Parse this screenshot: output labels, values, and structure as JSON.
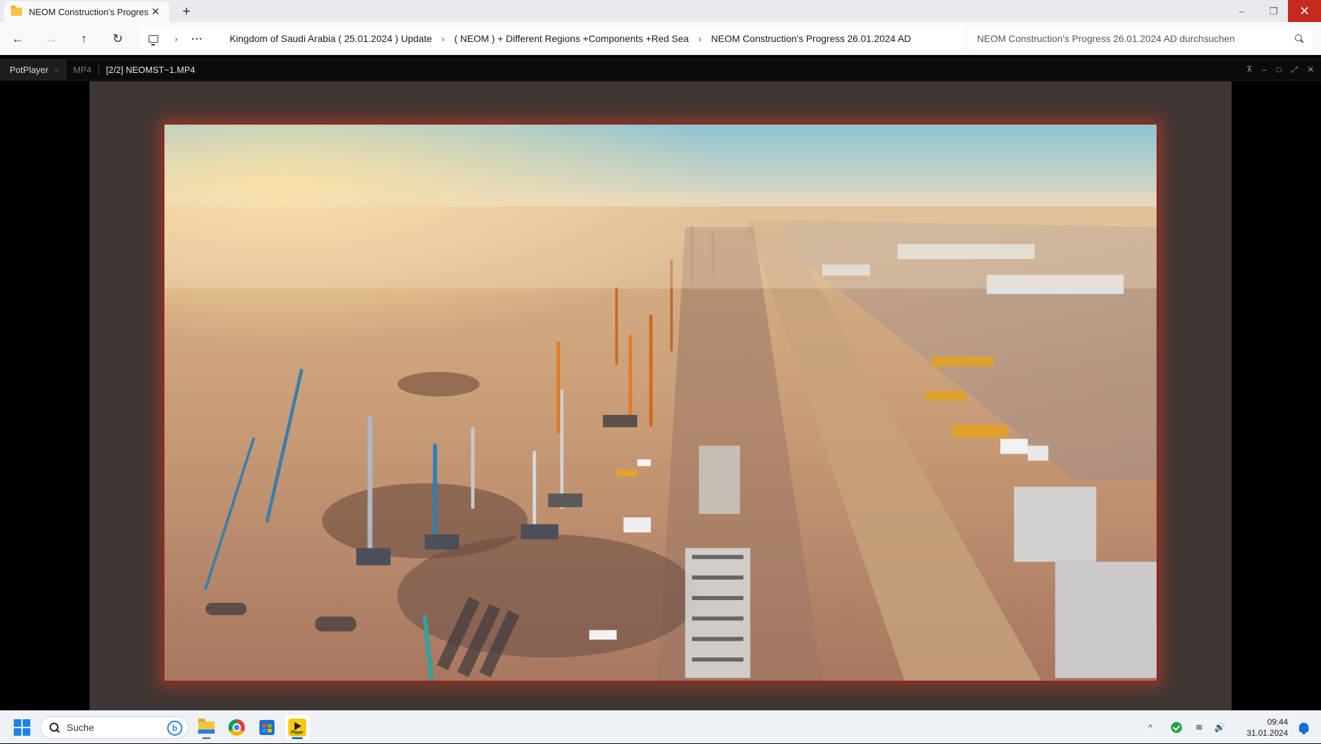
{
  "explorer": {
    "tab": {
      "title": "NEOM Construction's Progress",
      "close_glyph": "✕",
      "icon": "folder-icon"
    },
    "new_tab_glyph": "+",
    "window_controls": {
      "minimize": "–",
      "maximize": "❐",
      "close": "✕"
    },
    "nav": {
      "back": "←",
      "forward": "→",
      "up": "↑",
      "refresh": "↻"
    },
    "breadcrumb": {
      "overflow": "···",
      "items": [
        "Kingdom of Saudi Arabia ( 25.01.2024 ) Update",
        "( NEOM ) + Different Regions +Components +Red Sea",
        "NEOM Construction's Progress 26.01.2024 AD"
      ]
    },
    "search": {
      "placeholder": "NEOM Construction's Progress 26.01.2024 AD durchsuchen"
    }
  },
  "player": {
    "menu_label": "PotPlayer",
    "format": "MP4",
    "file_label": "[2/2] NEOMST~1.MP4",
    "controls": {
      "pin": "⊼",
      "minimize": "–",
      "maximize": "□",
      "fullscreen": "⤢",
      "close": "✕"
    },
    "frame_border_color": "#8a2a22"
  },
  "taskbar": {
    "search_placeholder": "Suche",
    "bing_glyph": "b",
    "potplayer_icon_text": "Player",
    "apps": [
      "file-explorer-icon",
      "chrome-icon",
      "microsoft-store-icon",
      "potplayer-icon"
    ],
    "tray": {
      "chevron": "^",
      "wifi": "≋",
      "volume": "🔊",
      "time": "09:44",
      "date": "31.01.2024"
    }
  }
}
